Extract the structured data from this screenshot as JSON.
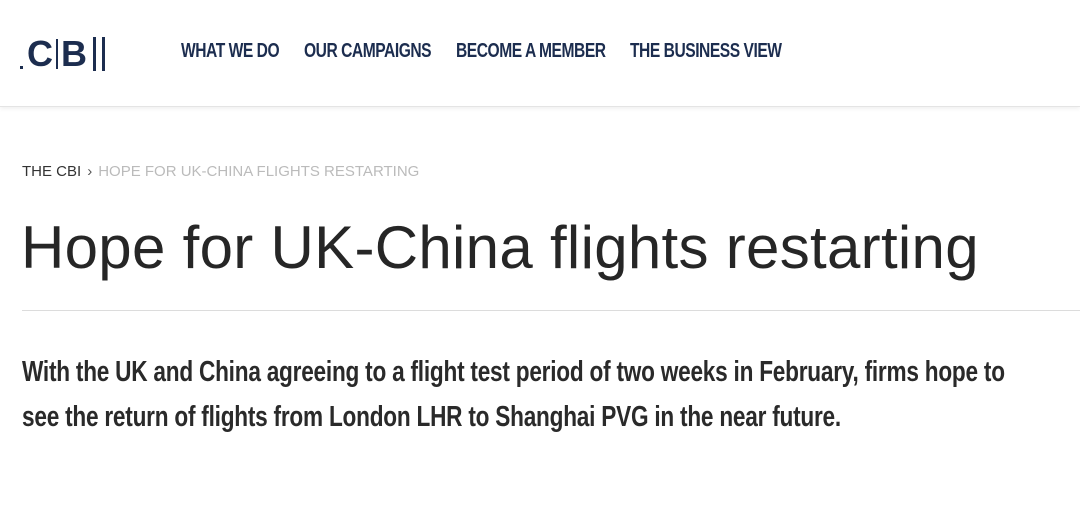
{
  "logo": {
    "letters": [
      "C",
      "B"
    ],
    "alt": "CBI"
  },
  "nav": {
    "items": [
      {
        "label": "WHAT WE DO"
      },
      {
        "label": "OUR CAMPAIGNS"
      },
      {
        "label": "BECOME A MEMBER"
      },
      {
        "label": "THE BUSINESS VIEW"
      }
    ]
  },
  "breadcrumb": {
    "root": "THE CBI",
    "separator": "›",
    "current": "HOPE FOR UK-CHINA FLIGHTS RESTARTING"
  },
  "article": {
    "title": "Hope for UK-China flights restarting",
    "lede": "With the UK and China agreeing to a flight test period of two weeks in February, firms hope to see the return of flights from London LHR to Shanghai PVG in the near future."
  },
  "colors": {
    "brand_navy": "#1c2d4f",
    "breadcrumb_current": "#bbbbbb",
    "text": "#262626"
  }
}
